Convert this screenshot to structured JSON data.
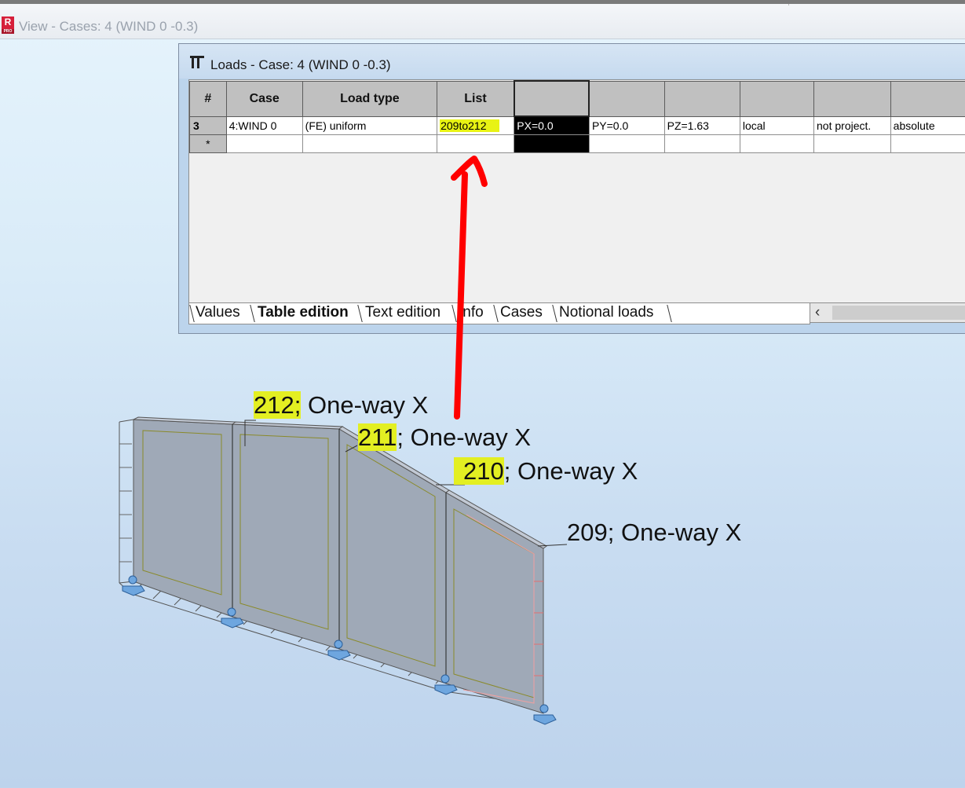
{
  "view": {
    "title": "View - Cases: 4 (WIND 0 -0.3)",
    "app_icon_letter": "R",
    "app_icon_sub": "PRO"
  },
  "loads_dialog": {
    "title": "Loads - Case: 4 (WIND 0 -0.3)",
    "columns": [
      "#",
      "Case",
      "Load type",
      "List",
      "",
      "",
      "",
      "",
      "",
      ""
    ],
    "rows": [
      [
        "3",
        "4:WIND 0",
        "(FE) uniform",
        "209to212",
        "PX=0.0",
        "PY=0.0",
        "PZ=1.63",
        "local",
        "not project.",
        "absolute"
      ],
      [
        "*",
        "",
        "",
        "",
        "",
        "",
        "",
        "",
        "",
        ""
      ]
    ],
    "tabs": [
      "Values",
      "Table edition",
      "Text edition",
      "Info",
      "Cases",
      "Notional loads"
    ],
    "active_tab": "Table edition",
    "highlight_color": "#e8f314"
  },
  "panels": [
    {
      "id": "212",
      "separator": ";",
      "type": "One-way X",
      "highlighted": true
    },
    {
      "id": "211",
      "separator": ";",
      "type": "One-way X",
      "highlighted": true
    },
    {
      "id": "210",
      "separator": ";",
      "type": "One-way X",
      "highlighted": true
    },
    {
      "id": "209",
      "separator": ";",
      "type": "One-way X",
      "highlighted": false
    }
  ],
  "annotation": {
    "arrow_color": "#ff0000"
  },
  "colors": {
    "panel_fill": "#9fa9b7",
    "support": "#5b9bd5",
    "panel_outline": "#8a8a2a"
  }
}
